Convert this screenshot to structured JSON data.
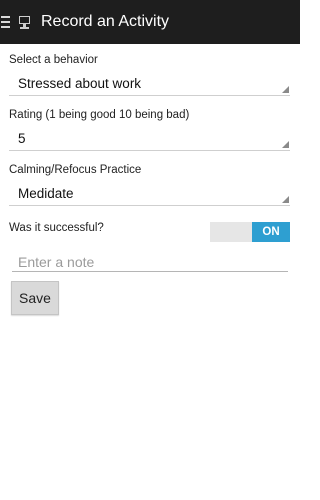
{
  "app_bar": {
    "title": "Record an Activity",
    "menu_icon": "menu-icon",
    "app_icon": "monitor-icon",
    "background": "#1e1e1e"
  },
  "form": {
    "behavior": {
      "label": "Select a behavior",
      "value": "Stressed about work"
    },
    "rating": {
      "label": "Rating (1 being good 10 being bad)",
      "value": "5"
    },
    "practice": {
      "label": "Calming/Refocus Practice",
      "value": "Medidate"
    },
    "success": {
      "label": "Was it successful?",
      "toggle_text": "ON",
      "toggle_color": "#2e9fd1"
    },
    "note": {
      "placeholder": "Enter a note",
      "value": ""
    },
    "save_label": "Save"
  }
}
